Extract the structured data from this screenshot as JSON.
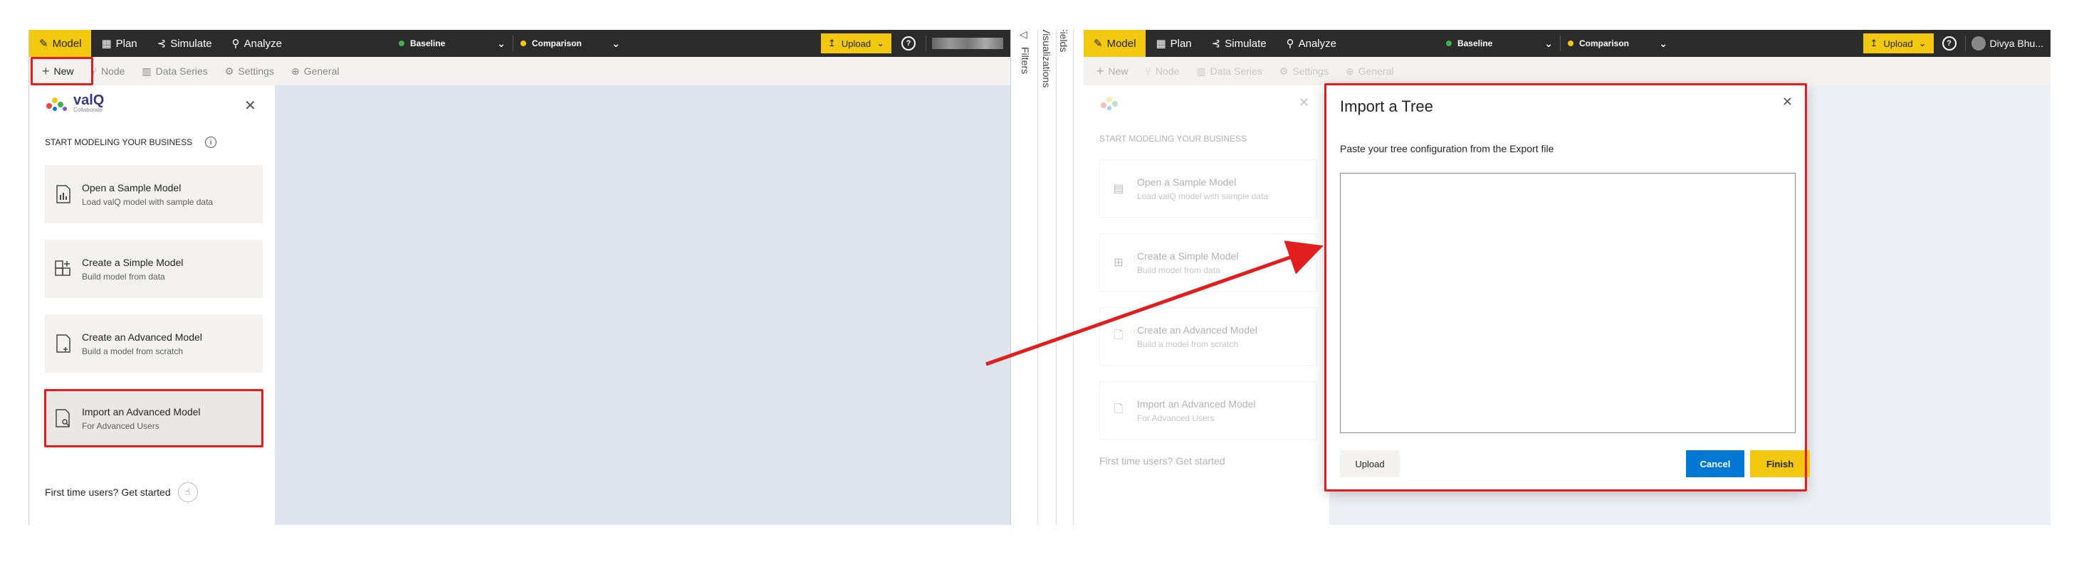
{
  "left": {
    "topbar": {
      "tabs": [
        {
          "label": "Model",
          "icon": "pencil-icon"
        },
        {
          "label": "Plan",
          "icon": "table-icon"
        },
        {
          "label": "Simulate",
          "icon": "simulate-icon"
        },
        {
          "label": "Analyze",
          "icon": "analyze-icon"
        }
      ],
      "baseline_label": "Baseline",
      "comparison_label": "Comparison",
      "upload_label": "Upload",
      "user_name": ""
    },
    "subbar": {
      "items": [
        {
          "label": "New"
        },
        {
          "label": "Node"
        },
        {
          "label": "Data Series"
        },
        {
          "label": "Settings"
        },
        {
          "label": "General"
        }
      ]
    },
    "side": {
      "logo_text": "valQ",
      "logo_subtext": "Collaborate",
      "heading": "START MODELING YOUR BUSINESS",
      "cards": [
        {
          "title": "Open a Sample Model",
          "subtitle": "Load valQ model with sample data"
        },
        {
          "title": "Create a Simple Model",
          "subtitle": "Build model from data"
        },
        {
          "title": "Create an Advanced Model",
          "subtitle": "Build a model from scratch"
        },
        {
          "title": "Import an Advanced Model",
          "subtitle": "For Advanced Users"
        }
      ],
      "first_time": "First time users? Get started"
    }
  },
  "panes": {
    "filters": "Filters",
    "visualizations": "Visualizations",
    "fields": "Fields"
  },
  "right": {
    "topbar": {
      "tabs": [
        {
          "label": "Model"
        },
        {
          "label": "Plan"
        },
        {
          "label": "Simulate"
        },
        {
          "label": "Analyze"
        }
      ],
      "baseline_label": "Baseline",
      "comparison_label": "Comparison",
      "upload_label": "Upload",
      "user_name": "Divya Bhu..."
    },
    "subbar": {
      "items": [
        {
          "label": "New"
        },
        {
          "label": "Node"
        },
        {
          "label": "Data Series"
        },
        {
          "label": "Settings"
        },
        {
          "label": "General"
        }
      ]
    },
    "side": {
      "heading": "START MODELING YOUR BUSINESS",
      "cards": [
        {
          "title": "Open a Sample Model",
          "subtitle": "Load valQ model with sample data"
        },
        {
          "title": "Create a Simple Model",
          "subtitle": "Build model from data"
        },
        {
          "title": "Create an Advanced Model",
          "subtitle": "Build a model from scratch"
        },
        {
          "title": "Import an Advanced Model",
          "subtitle": "For Advanced Users"
        }
      ],
      "first_time": "First time users? Get started"
    },
    "dialog": {
      "title": "Import a Tree",
      "instruction": "Paste your tree configuration from the Export file",
      "textarea_value": "",
      "upload_label": "Upload",
      "cancel_label": "Cancel",
      "finish_label": "Finish"
    }
  },
  "colors": {
    "accent": "#f2c811",
    "topbar": "#2b2b2b",
    "highlight": "#e21d1d",
    "primary": "#0078d4",
    "baseline_dot": "#3cb44b"
  }
}
